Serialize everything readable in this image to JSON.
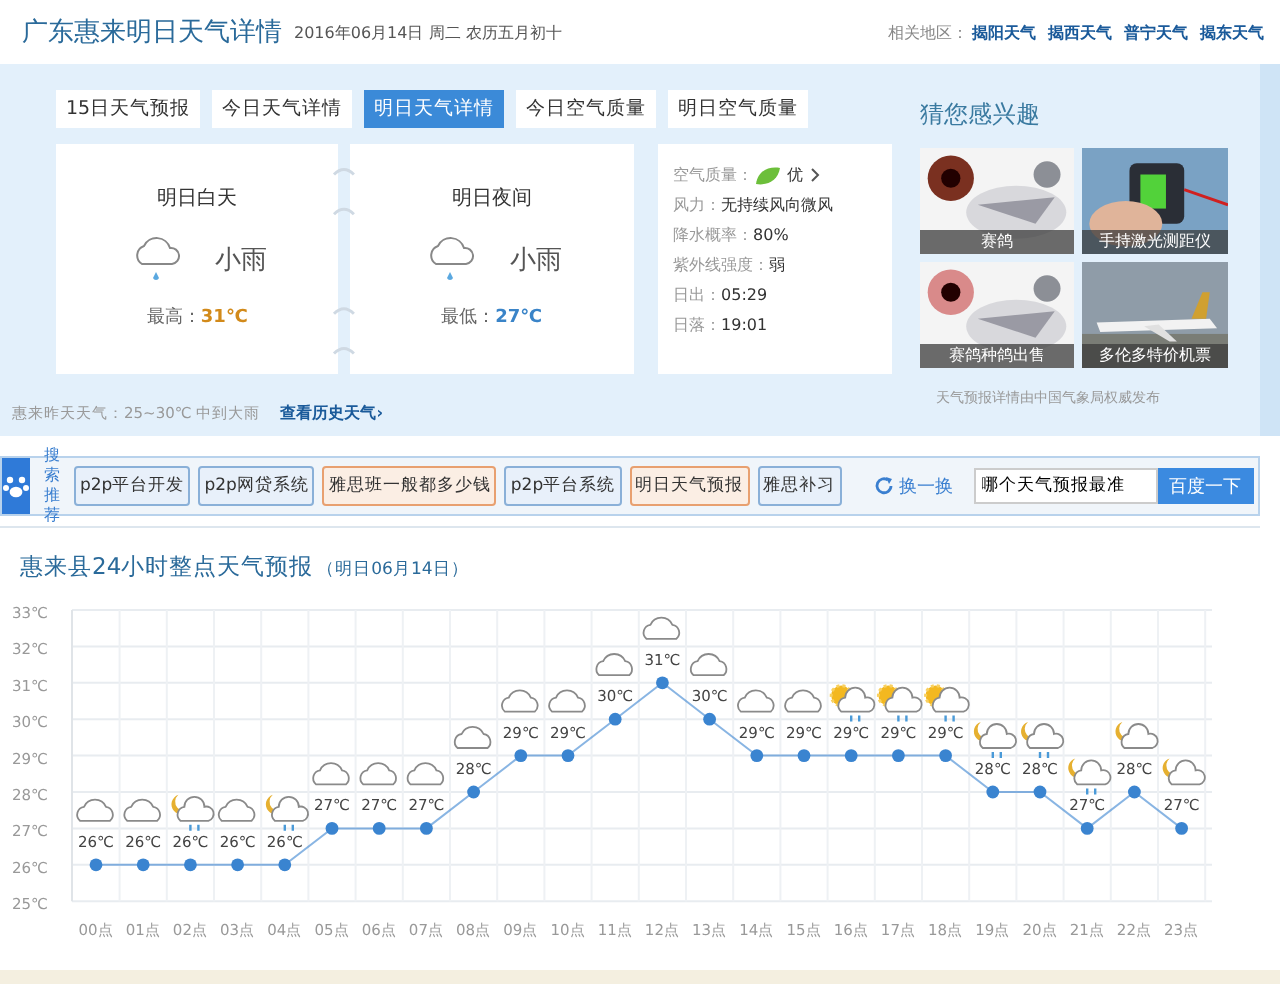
{
  "header": {
    "title": "广东惠来明日天气详情",
    "date": "2016年06月14日 周二 农历五月初十",
    "related_label": "相关地区：",
    "related_links": [
      "揭阳天气",
      "揭西天气",
      "普宁天气",
      "揭东天气"
    ]
  },
  "tabs": [
    {
      "label": "15日天气预报",
      "selected": false
    },
    {
      "label": "今日天气详情",
      "selected": false
    },
    {
      "label": "明日天气详情",
      "selected": true
    },
    {
      "label": "今日空气质量",
      "selected": false
    },
    {
      "label": "明日空气质量",
      "selected": false
    }
  ],
  "periods": [
    {
      "title": "明日白天",
      "weather": "小雨",
      "temp_label": "最高：",
      "temp": "31℃",
      "kind": "high"
    },
    {
      "title": "明日夜间",
      "weather": "小雨",
      "temp_label": "最低：",
      "temp": "27℃",
      "kind": "low"
    }
  ],
  "details": {
    "air_label": "空气质量：",
    "air_value": "优",
    "rows": [
      {
        "label": "风力：",
        "value": "无持续风向微风"
      },
      {
        "label": "降水概率：",
        "value": "80%"
      },
      {
        "label": "紫外线强度：",
        "value": "弱"
      },
      {
        "label": "日出：",
        "value": "05:29"
      },
      {
        "label": "日落：",
        "value": "19:01"
      }
    ]
  },
  "interest": {
    "title": "猜您感兴趣",
    "items": [
      {
        "caption": "赛鸽",
        "kind": "picture"
      },
      {
        "caption": "手持激光测距仪",
        "kind": "picture"
      },
      {
        "caption": "赛鸽种鸽出售",
        "kind": "picture"
      },
      {
        "caption": "多伦多特价机票",
        "kind": "picture"
      }
    ]
  },
  "yesterday": "惠来昨天天气：25~30℃ 中到大雨",
  "history_link": "查看历史天气›",
  "source": "天气预报详情由中国气象局权威发布",
  "search": {
    "label": "搜索推荐",
    "tags": [
      {
        "text": "p2p平台开发",
        "highlighted": false
      },
      {
        "text": "p2p网贷系统",
        "highlighted": false
      },
      {
        "text": "雅思班一般都多少钱",
        "highlighted": true
      },
      {
        "text": "p2p平台系统",
        "highlighted": false
      },
      {
        "text": "明日天气预报",
        "highlighted": true
      },
      {
        "text": "雅思补习",
        "highlighted": false
      }
    ],
    "refresh": "换一换",
    "query": "哪个天气预报最准",
    "button": "百度一下"
  },
  "forecast": {
    "title": "惠来县24小时整点天气预报",
    "subtitle": "（明日06月14日）",
    "icons": [
      {
        "kind": "cloudy"
      },
      {
        "kind": "cloudy"
      },
      {
        "kind": "night-rain"
      },
      {
        "kind": "cloudy"
      },
      {
        "kind": "night-rain"
      },
      {
        "kind": "cloudy"
      },
      {
        "kind": "cloudy"
      },
      {
        "kind": "cloudy"
      },
      {
        "kind": "cloudy"
      },
      {
        "kind": "cloudy"
      },
      {
        "kind": "cloudy"
      },
      {
        "kind": "cloudy"
      },
      {
        "kind": "cloudy"
      },
      {
        "kind": "cloudy"
      },
      {
        "kind": "cloudy"
      },
      {
        "kind": "cloudy"
      },
      {
        "kind": "sun-rain"
      },
      {
        "kind": "sun-rain"
      },
      {
        "kind": "sun-rain"
      },
      {
        "kind": "night-rain"
      },
      {
        "kind": "night-rain"
      },
      {
        "kind": "night-rain"
      },
      {
        "kind": "night-cloudy"
      },
      {
        "kind": "night-cloudy"
      }
    ],
    "chart_data": {
      "type": "line",
      "categories": [
        "00点",
        "01点",
        "02点",
        "03点",
        "04点",
        "05点",
        "06点",
        "07点",
        "08点",
        "09点",
        "10点",
        "11点",
        "12点",
        "13点",
        "14点",
        "15点",
        "16点",
        "17点",
        "18点",
        "19点",
        "20点",
        "21点",
        "22点",
        "23点"
      ],
      "grid": true,
      "series": [
        {
          "color": "#3a84d0",
          "marker": true,
          "values": [
            26,
            26,
            26,
            26,
            26,
            27,
            27,
            27,
            28,
            29,
            29,
            30,
            31,
            30,
            29,
            29,
            29,
            29,
            29,
            28,
            28,
            27,
            28,
            27
          ]
        }
      ],
      "value_labels": [
        "26℃",
        "26℃",
        "26℃",
        "26℃",
        "26℃",
        "27℃",
        "27℃",
        "27℃",
        "28℃",
        "29℃",
        "29℃",
        "30℃",
        "31℃",
        "30℃",
        "29℃",
        "29℃",
        "29℃",
        "29℃",
        "29℃",
        "28℃",
        "28℃",
        "27℃",
        "28℃",
        "27℃"
      ],
      "ylim": [
        25,
        33
      ],
      "yticks": [
        {
          "value": 25,
          "label": "25℃"
        },
        {
          "value": 26,
          "label": "26℃"
        },
        {
          "value": 27,
          "label": "27℃"
        },
        {
          "value": 28,
          "label": "28℃"
        },
        {
          "value": 29,
          "label": "29℃"
        },
        {
          "value": 30,
          "label": "30℃"
        },
        {
          "value": 31,
          "label": "31℃"
        },
        {
          "value": 32,
          "label": "32℃"
        },
        {
          "value": 33,
          "label": "33℃"
        }
      ]
    }
  }
}
